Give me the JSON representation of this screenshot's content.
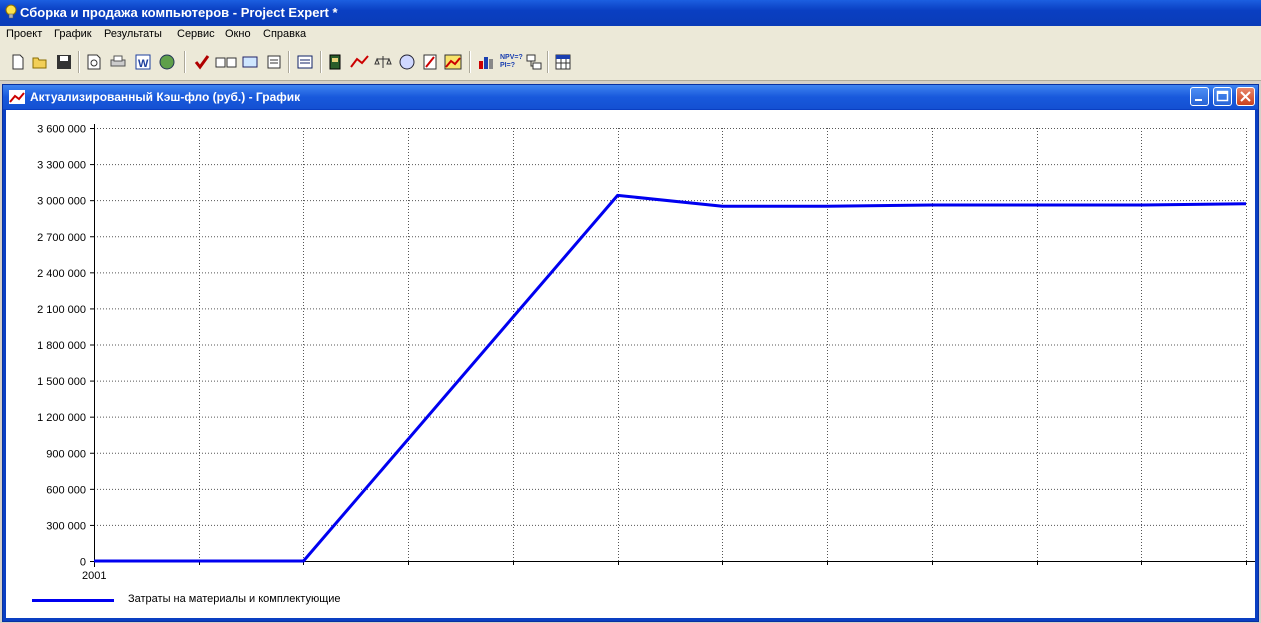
{
  "app": {
    "title": "Сборка и продажа компьютеров - Project Expert *"
  },
  "menu": [
    {
      "label": "Проект"
    },
    {
      "label": "График"
    },
    {
      "label": "Результаты"
    },
    {
      "label": "Сервис"
    },
    {
      "label": "Окно"
    },
    {
      "label": "Справка"
    }
  ],
  "toolbar": {
    "buttons": [
      "new-file-icon",
      "open-folder-icon",
      "save-icon",
      "print-preview-icon",
      "print-icon",
      "word-export-icon",
      "web-export-icon",
      "check-icon",
      "checklist-icon",
      "refresh-link-icon",
      "notes-icon",
      "report-icon",
      "book-icon",
      "cashflow-chart-icon",
      "balance-scale-icon",
      "calculator-icon",
      "ruler-icon",
      "area-chart-icon",
      "bar-chart-icon",
      "npv-pi-icon",
      "tree-icon",
      "table-icon"
    ],
    "npv_text": "NPV=?",
    "pi_text": "PI=?"
  },
  "child_window": {
    "title": "Актуализированный Кэш-фло (руб.) - График"
  },
  "chart_data": {
    "type": "line",
    "title": "",
    "xlabel": "2001",
    "ylabel": "",
    "ylim": [
      0,
      3600000
    ],
    "ytick_values": [
      0,
      300000,
      600000,
      900000,
      1200000,
      1500000,
      1800000,
      2100000,
      2400000,
      2700000,
      3000000,
      3300000,
      3600000
    ],
    "ytick_labels": [
      "0",
      "300 000",
      "600 000",
      "900 000",
      "1 200 000",
      "1 500 000",
      "1 800 000",
      "2 100 000",
      "2 400 000",
      "2 700 000",
      "3 000 000",
      "3 300 000",
      "3 600 000"
    ],
    "x_periods": 11,
    "grid": true,
    "legend_position": "bottom-left",
    "series": [
      {
        "name": "Затраты на материалы и комплектующие",
        "color": "#0000f0",
        "points": [
          [
            0,
            0
          ],
          [
            2,
            0
          ],
          [
            5,
            3040000
          ],
          [
            6,
            2950000
          ],
          [
            7,
            2950000
          ],
          [
            8,
            2960000
          ],
          [
            9,
            2960000
          ],
          [
            10,
            2960000
          ],
          [
            11,
            2970000
          ]
        ]
      }
    ],
    "year_label": "2001"
  }
}
